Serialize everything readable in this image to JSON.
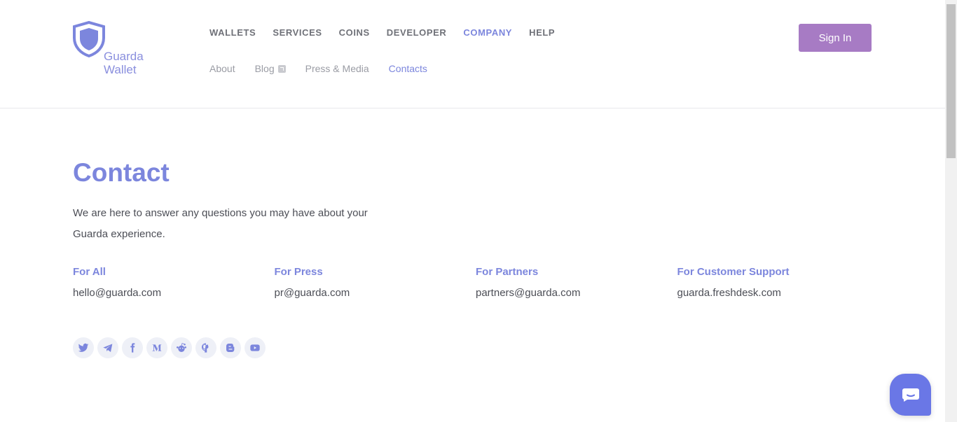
{
  "brand": {
    "line1": "Guarda",
    "line2": "Wallet",
    "accent": "#7c86dd",
    "button": "#a77bc4"
  },
  "nav": {
    "main": [
      {
        "label": "WALLETS"
      },
      {
        "label": "SERVICES"
      },
      {
        "label": "COINS"
      },
      {
        "label": "DEVELOPER"
      },
      {
        "label": "COMPANY",
        "active": true
      },
      {
        "label": "HELP"
      }
    ],
    "sub": [
      {
        "label": "About"
      },
      {
        "label": "Blog",
        "external": true
      },
      {
        "label": "Press & Media"
      },
      {
        "label": "Contacts",
        "active": true
      }
    ]
  },
  "header": {
    "sign_in": "Sign In"
  },
  "page": {
    "title": "Contact",
    "intro": "We are here to answer any questions you may have about your Guarda experience."
  },
  "contacts": [
    {
      "heading": "For All",
      "email": "hello@guarda.com"
    },
    {
      "heading": "For Press",
      "email": "pr@guarda.com"
    },
    {
      "heading": "For Partners",
      "email": "partners@guarda.com"
    },
    {
      "heading": "For Customer Support",
      "email": "guarda.freshdesk.com"
    }
  ],
  "social": [
    "twitter-icon",
    "telegram-icon",
    "facebook-icon",
    "medium-icon",
    "reddit-icon",
    "github-icon",
    "blogger-icon",
    "youtube-icon"
  ],
  "chat_widget": {
    "icon": "chat-bubble-icon"
  }
}
